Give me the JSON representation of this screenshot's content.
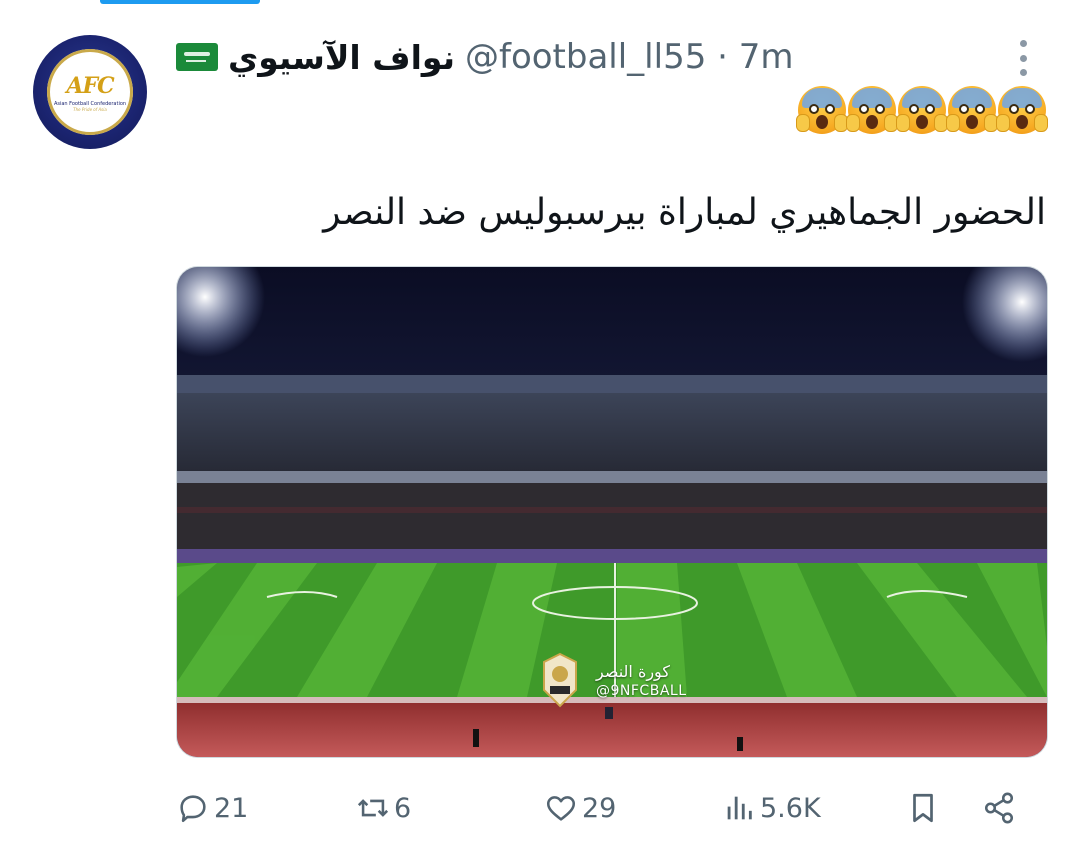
{
  "tweet": {
    "author": {
      "display_name": "نواف الآسيوي",
      "handle": "@football_ll55",
      "time": "· 7m",
      "flag_icon": "saudi-flag-icon",
      "avatar_icon": "afc-logo-icon",
      "avatar_logo_text": "AFC",
      "avatar_sub_text": "Asian Football Confederation",
      "avatar_sub_text2": "The Pride of Asia"
    },
    "emoji_line": [
      "face-screaming-in-fear",
      "face-screaming-in-fear",
      "face-screaming-in-fear",
      "face-screaming-in-fear",
      "face-screaming-in-fear"
    ],
    "text": "الحضور الجماهيري لمباراة بيرسبوليس ضد النصر",
    "media": {
      "watermark_name": "كورة النصر",
      "watermark_handle": "@9NFCBALL"
    },
    "actions": {
      "replies": "21",
      "reposts": "6",
      "likes": "29",
      "views": "5.6K"
    }
  },
  "colors": {
    "accent": "#1d9bf0",
    "secondary_text": "#536471",
    "pitch_green": "#3f9a2a"
  }
}
